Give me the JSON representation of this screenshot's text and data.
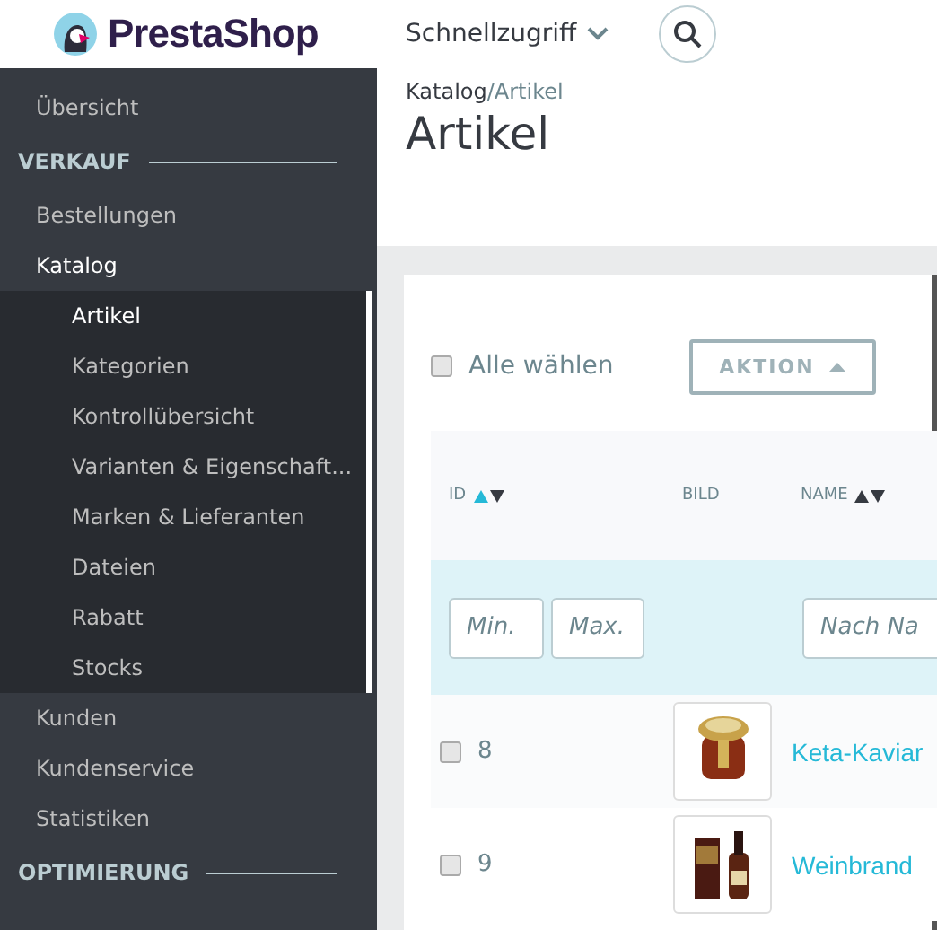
{
  "header": {
    "logo": "PrestaShop",
    "quick_access": "Schnellzugriff"
  },
  "sidebar": {
    "items": [
      {
        "kind": "item",
        "label": "Übersicht",
        "selected": false
      },
      {
        "kind": "section",
        "label": "VERKAUF"
      },
      {
        "kind": "item",
        "label": "Bestellungen",
        "selected": false
      },
      {
        "kind": "item",
        "label": "Katalog",
        "selected": true,
        "children": [
          {
            "label": "Artikel",
            "selected": true
          },
          {
            "label": "Kategorien",
            "selected": false
          },
          {
            "label": "Kontrollübersicht",
            "selected": false
          },
          {
            "label": "Varianten & Eigenschaft...",
            "selected": false
          },
          {
            "label": "Marken & Lieferanten",
            "selected": false
          },
          {
            "label": "Dateien",
            "selected": false
          },
          {
            "label": "Rabatt",
            "selected": false
          },
          {
            "label": "Stocks",
            "selected": false
          }
        ]
      },
      {
        "kind": "item",
        "label": "Kunden",
        "selected": false
      },
      {
        "kind": "item",
        "label": "Kundenservice",
        "selected": false
      },
      {
        "kind": "item",
        "label": "Statistiken",
        "selected": false
      },
      {
        "kind": "section",
        "label": "OPTIMIERUNG"
      }
    ]
  },
  "breadcrumb": [
    "Katalog",
    "/Artikel"
  ],
  "page_title": "Artikel",
  "bulk": {
    "select_all": "Alle wählen",
    "checked": false,
    "action": "AKTION"
  },
  "table": {
    "columns": [
      {
        "label": "ID",
        "sortable": true,
        "sorted_asc": true
      },
      {
        "label": "BILD",
        "sortable": false,
        "sorted_asc": false
      },
      {
        "label": "NAME",
        "sortable": true,
        "sorted_asc": false
      }
    ],
    "filters": [
      {
        "placeholder": "Min."
      },
      {
        "placeholder": "Max."
      },
      {
        "placeholder": "Nach Na"
      }
    ],
    "rows": [
      {
        "id": "8",
        "name": "Keta-Kaviar",
        "checked": false
      },
      {
        "id": "9",
        "name": "Weinbrand",
        "checked": false
      }
    ]
  }
}
